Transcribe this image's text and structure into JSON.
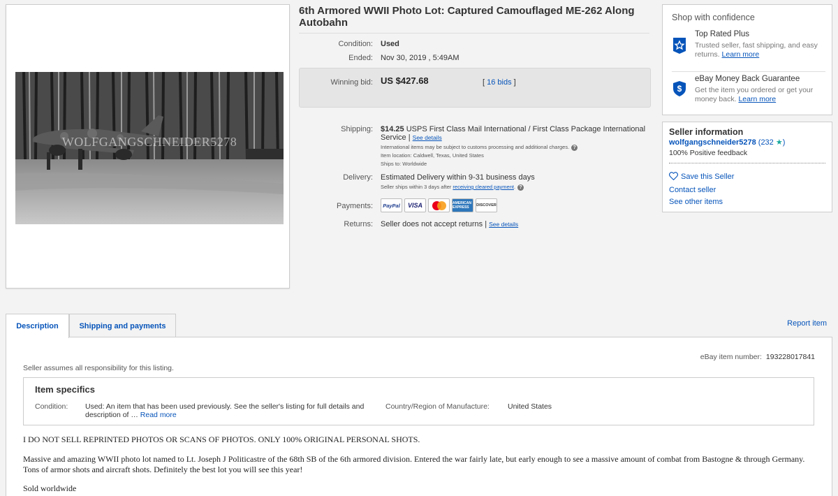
{
  "photo": {
    "watermark": "WOLFGANGSCHNEIDER5278"
  },
  "item": {
    "title": "6th Armored WWII Photo Lot: Captured Camouflaged ME-262 Along Autobahn",
    "condition_label": "Condition:",
    "condition_value": "Used",
    "ended_label": "Ended:",
    "ended_value": "Nov 30, 2019 , 5:49AM",
    "bid_label": "Winning bid:",
    "bid_amount": "US $427.68",
    "bid_open": "[",
    "bid_count": "16 bids",
    "bid_close": "]"
  },
  "shipping": {
    "label": "Shipping:",
    "price": "$14.25",
    "service": "USPS First Class Mail International / First Class Package International Service |",
    "see_details": "See details",
    "note1": "International items may be subject to customs processing and additional charges.",
    "note2": "Item location:  Caldwell, Texas, United States",
    "note3": "Ships to:  Worldwide"
  },
  "delivery": {
    "label": "Delivery:",
    "value": "Estimated Delivery within 9-31 business days",
    "note_prefix": "Seller ships within 3 days after",
    "note_link": "receiving cleared payment",
    "note_suffix": "."
  },
  "payments": {
    "label": "Payments:",
    "methods": [
      "PayPal",
      "VISA",
      "MasterCard",
      "AMERICAN EXPRESS",
      "DISCOVER"
    ]
  },
  "returns": {
    "label": "Returns:",
    "value": "Seller does not accept returns |",
    "see_details": "See details"
  },
  "confidence": {
    "heading": "Shop with confidence",
    "top_rated_title": "Top Rated Plus",
    "top_rated_desc": "Trusted seller, fast shipping, and easy returns.",
    "top_rated_link": "Learn more",
    "mbg_title": "eBay Money Back Guarantee",
    "mbg_desc": "Get the item you ordered or get your money back.",
    "mbg_link": "Learn more"
  },
  "seller": {
    "heading": "Seller information",
    "name": "wolfgangschneider5278",
    "score": "(232",
    "score_close": ")",
    "feedback": "100% Positive feedback",
    "save": "Save this Seller",
    "contact": "Contact seller",
    "other": "See other items"
  },
  "tabs": {
    "description": "Description",
    "shipping": "Shipping and payments",
    "report": "Report item"
  },
  "description": {
    "item_number_label": "eBay item number:",
    "item_number": "193228017841",
    "responsibility": "Seller assumes all responsibility for this listing.",
    "specifics_heading": "Item specifics",
    "condition_label": "Condition:",
    "condition_value": "Used: An item that has been used previously. See the seller's listing for full details and description of …",
    "read_more": "Read more",
    "country_label": "Country/Region of Manufacture:",
    "country_value": "United States",
    "para1": "I DO NOT SELL REPRINTED PHOTOS OR SCANS OF PHOTOS. ONLY 100% ORIGINAL PERSONAL SHOTS.",
    "para2": "Massive and amazing WWII photo lot named to Lt. Joseph J Politicastre of the 68th SB of the 6th armored division. Entered the war fairly late, but early enough to see a massive amount of combat from Bastogne & through Germany. Tons of armor shots and aircraft shots. Definitely the best lot you will see this year!",
    "para3": "Sold worldwide"
  },
  "colors": {
    "link": "#0654ba",
    "star": "#18a89e",
    "badge": "#0654ba"
  }
}
